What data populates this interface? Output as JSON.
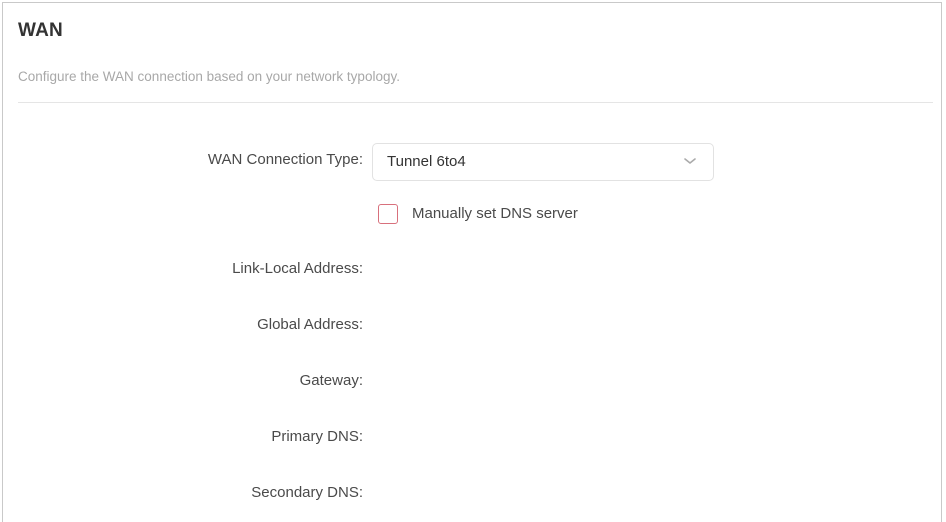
{
  "section": {
    "title": "WAN",
    "subtitle": "Configure the WAN connection based on your network typology."
  },
  "form": {
    "connection_type_label": "WAN Connection Type:",
    "connection_type_value": "Tunnel 6to4",
    "manual_dns_label": "Manually set DNS server",
    "manual_dns_checked": false,
    "link_local_label": "Link-Local Address:",
    "global_address_label": "Global Address:",
    "gateway_label": "Gateway:",
    "primary_dns_label": "Primary DNS:",
    "secondary_dns_label": "Secondary DNS:"
  },
  "icons": {
    "dropdown": "chevron-down-icon",
    "checkbox": "checkbox-unchecked"
  },
  "colors": {
    "checkbox_border": "#d8707c",
    "subtitle_text": "#a8a8a8"
  }
}
